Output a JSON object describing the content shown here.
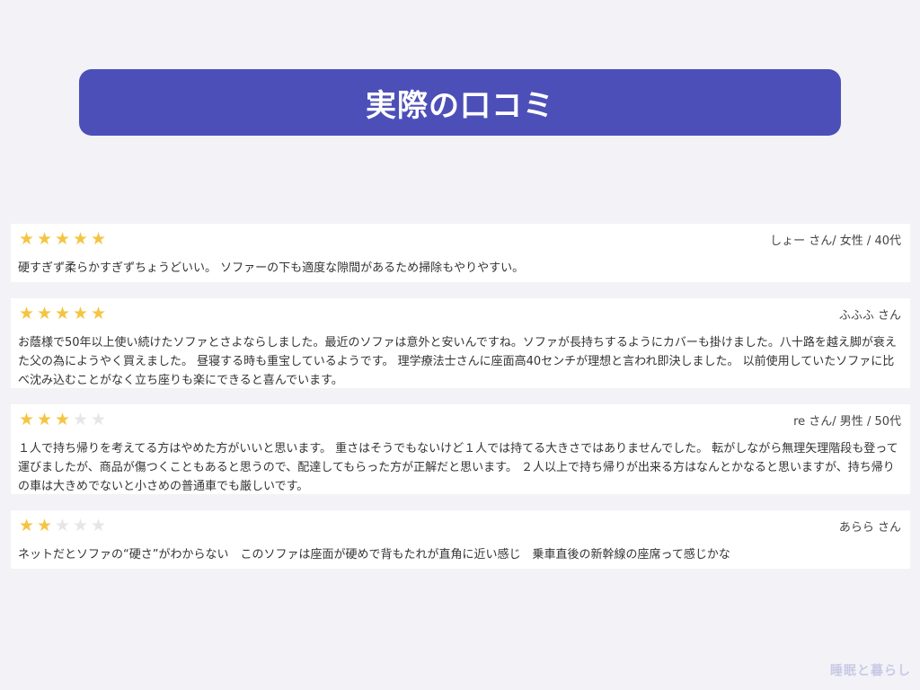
{
  "page": {
    "title": "実際の口コミ",
    "watermark": "睡眠と暮らし",
    "colors": {
      "banner": "#4d4fb8",
      "background": "#f2f2f7",
      "star_on": "#f4c542",
      "star_off": "#e6e6e6"
    }
  },
  "reviews": [
    {
      "rating": 5,
      "reviewer": "しょー さん/ 女性 / 40代",
      "text": "硬すぎず柔らかすぎずちょうどいい。 ソファーの下も適度な隙間があるため掃除もやりやすい。"
    },
    {
      "rating": 5,
      "reviewer": "ふふふ さん",
      "text": "お蔭様で50年以上使い続けたソファとさよならしました。最近のソファは意外と安いんですね。ソファが長持ちするようにカバーも掛けました。八十路を越え脚が衰えた父の為にようやく買えました。 昼寝する時も重宝しているようです。 理学療法士さんに座面高40センチが理想と言われ即決しました。 以前使用していたソファに比べ沈み込むことがなく立ち座りも楽にできると喜んでいます。"
    },
    {
      "rating": 3,
      "reviewer": "re さん/ 男性 / 50代",
      "text": "１人で持ち帰りを考えてる方はやめた方がいいと思います。 重さはそうでもないけど１人では持てる大きさではありませんでした。 転がしながら無理矢理階段も登って運びましたが、商品が傷つくこともあると思うので、配達してもらった方が正解だと思います。 ２人以上で持ち帰りが出来る方はなんとかなると思いますが、持ち帰りの車は大きめでないと小さめの普通車でも厳しいです。"
    },
    {
      "rating": 2,
      "reviewer": "あらら さん",
      "text": "ネットだとソファの“硬さ”がわからない　このソファは座面が硬めで背もたれが直角に近い感じ　乗車直後の新幹線の座席って感じかな"
    }
  ]
}
